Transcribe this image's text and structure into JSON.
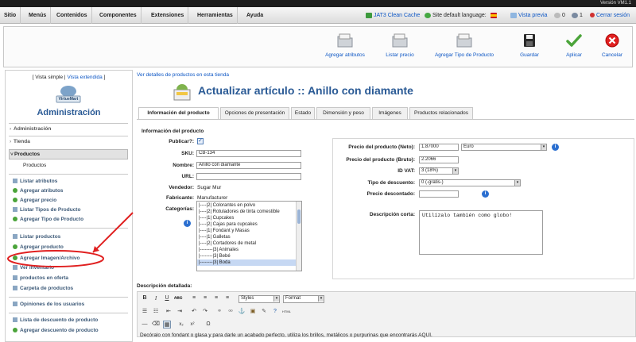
{
  "top_bar": {
    "text": "Versión VM1.1"
  },
  "menu": [
    "Sitio",
    "Menús",
    "Contenidos",
    "Componentes",
    "Extensiones",
    "Herramientas",
    "Ayuda"
  ],
  "status": {
    "cache": "JAT3 Clean Cache",
    "language": "Site default language:",
    "preview": "Vista previa",
    "messages": "0",
    "users": "1",
    "logout": "Cerrar sesión"
  },
  "toolbar": {
    "add_attributes": "Agregar atributos",
    "list_price": "Listar precio",
    "add_product_type": "Agregar Tipo de Producto",
    "save": "Guardar",
    "apply": "Aplicar",
    "cancel": "Cancelar"
  },
  "sidebar": {
    "view_simple": "[ Vista simple",
    "view_extended": "Vista extendida",
    "view_close": " ]",
    "logo_text": "VirtueMart",
    "admin_title": "Administración",
    "sections": {
      "admin": "Administración",
      "store": "Tienda",
      "products": "Productos"
    },
    "products_label": "Productos",
    "items": [
      "Listar atributos",
      "Agregar atributos",
      "Agregar precio",
      "Listar Tipos de Producto",
      "Agregar Tipo de Producto",
      "Listar productos",
      "Agregar producto",
      "Agregar Imagen/Archivo",
      "Ver inventario",
      "productos en oferta",
      "Carpeta de productos",
      "Opiniones de los usuarios",
      "Lista de descuento de producto",
      "Agregar descuento de producto"
    ]
  },
  "main": {
    "breadcrumb": "Ver detalles de productos en esta tienda",
    "title": "Actualizar artículo :: Anillo con diamante",
    "tabs": [
      "Información del producto",
      "Opciones de presentación",
      "Estado",
      "Dimensión y peso",
      "Imágenes",
      "Productos relacionados"
    ],
    "section_title": "Información del producto",
    "fields": {
      "publish_label": "Publicar?:",
      "sku_label": "SKU:",
      "sku": "CB-134",
      "name_label": "Nombre:",
      "name": "Anillo con diamante",
      "url_label": "URL:",
      "url": "",
      "vendor_label": "Vendedor:",
      "vendor": "Sugar Mur",
      "manufacturer_label": "Fabricante:",
      "manufacturer": "Manufacturer",
      "categories_label": "Categorías:"
    },
    "categories": [
      "|----|2| Colorantes en polvo",
      "|----|2| Rotuladores de tinta comestible",
      "|----|1| Cupcakes",
      "|----|2| Cajas para cupcakes",
      "|----|1| Fondant y Masas",
      "|----|1| Galletas",
      "|----|2| Cortadores de metal",
      "|--------|3| Animales",
      "|--------|3| Bebé",
      "|--------|3| Boda"
    ],
    "price": {
      "net_label": "Precio del producto (Neto):",
      "net": "1.87000",
      "currency": "Euro",
      "gross_label": "Precio del producto (Bruto):",
      "gross": "2.2066",
      "vat_label": "ID VAT:",
      "vat": "3 (18%)",
      "discount_type_label": "Tipo de descuento:",
      "discount_type": "0 (-gratis-)",
      "discounted_label": "Precio descontado:",
      "discounted": "",
      "short_desc_label": "Descripción corta:",
      "short_desc": "Utilízalo también como globo!"
    },
    "editor": {
      "label": "Descripción detallada:",
      "styles": "Styles",
      "format": "Format",
      "body": "Decóralo con fondant o glasa y para darle un acabado perfecto, utiliza los brillos, metálicos o purpurinas que encontrarás AQUÍ."
    }
  },
  "colors": {
    "link": "#0b55c4",
    "accent_red": "#e02020",
    "icon_green": "#4ba43a"
  }
}
